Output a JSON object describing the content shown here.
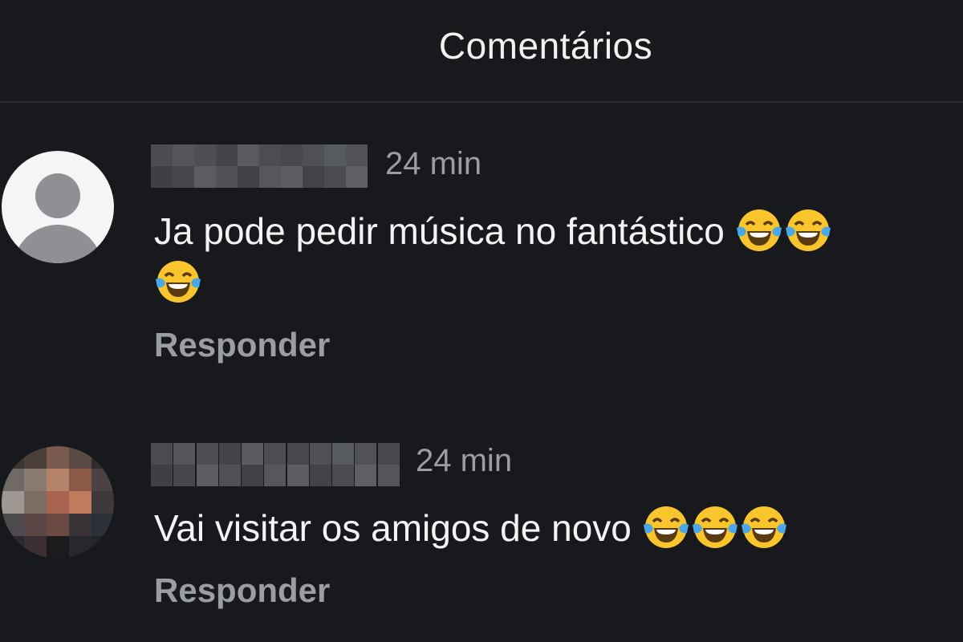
{
  "header": {
    "title": "Comentários"
  },
  "comments": [
    {
      "time": "24 min",
      "text": "Ja pode pedir música no fantástico",
      "emoji_line1_count": 2,
      "emoji_line2_count": 1,
      "reply_label": "Responder",
      "avatar": "default-user-icon"
    },
    {
      "time": "24 min",
      "text": "Vai visitar os amigos de novo",
      "emoji_count": 3,
      "reply_label": "Responder",
      "avatar": "pixelated-photo"
    }
  ],
  "colors": {
    "background": "#18191c",
    "text": "#f2f3f5",
    "muted": "#9a9da3",
    "divider": "#2a2c30"
  },
  "icons": {
    "laughing": "face-with-tears-of-joy-icon"
  }
}
